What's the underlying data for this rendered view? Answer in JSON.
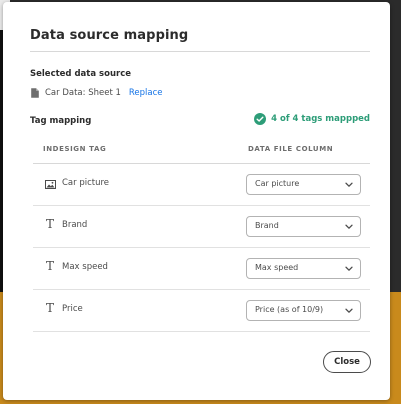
{
  "dialog": {
    "title": "Data source mapping",
    "selected_source_label": "Selected data source",
    "source_name": "Car Data: Sheet 1",
    "replace_label": "Replace",
    "tag_mapping_label": "Tag mapping",
    "mapped_status": "4 of 4 tags mappped",
    "close_label": "Close"
  },
  "table": {
    "columns": [
      "INDESIGN TAG",
      "DATA FILE COLUMN"
    ],
    "rows": [
      {
        "icon": "image-icon",
        "tag": "Car picture",
        "column": "Car picture"
      },
      {
        "icon": "text-icon",
        "tag": "Brand",
        "column": "Brand"
      },
      {
        "icon": "text-icon",
        "tag": "Max speed",
        "column": "Max speed"
      },
      {
        "icon": "text-icon",
        "tag": "Price",
        "column": "Price (as of 10/9)"
      }
    ]
  },
  "colors": {
    "accent_link": "#1473e6",
    "success": "#2d9d78",
    "backdrop_orange": "#c98a1c"
  }
}
